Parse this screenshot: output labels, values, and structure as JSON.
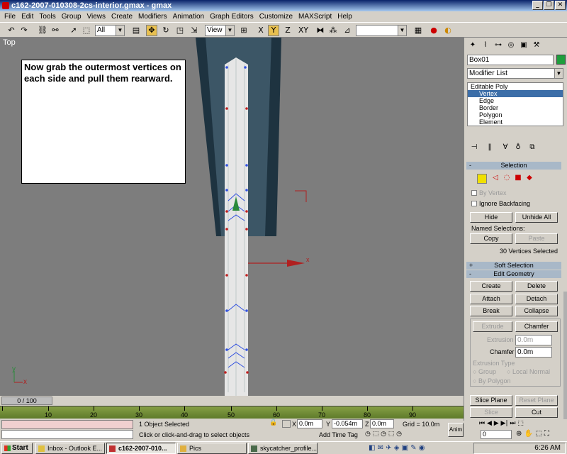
{
  "window": {
    "title": "c162-2007-010308-2cs-interior.gmax - gmax",
    "buttons": [
      "_",
      "❐",
      "✕"
    ]
  },
  "menu": [
    "File",
    "Edit",
    "Tools",
    "Group",
    "Views",
    "Create",
    "Modifiers",
    "Animation",
    "Graph Editors",
    "Customize",
    "MAXScript",
    "Help"
  ],
  "toolbar": {
    "selection_filter": "All",
    "ref_coord": "View",
    "named_sel": ""
  },
  "viewport": {
    "label": "Top",
    "note": "Now grab the outermost vertices on each side and pull them rearward.",
    "axis_y": "y",
    "axis_x": "x"
  },
  "command_panel": {
    "object_name": "Box01",
    "object_color": "#1e9e3c",
    "modifier_list": "Modifier List",
    "stack": [
      "Editable Poly",
      "Vertex",
      "Edge",
      "Border",
      "Polygon",
      "Element"
    ],
    "selection": {
      "title": "Selection",
      "by_vertex": "By Vertex",
      "ignore_backfacing": "Ignore Backfacing",
      "hide": "Hide",
      "unhide_all": "Unhide All",
      "named_selections": "Named Selections:",
      "copy": "Copy",
      "paste": "Paste",
      "status": "30 Vertices Selected"
    },
    "soft_selection": "Soft Selection",
    "edit_geometry": {
      "title": "Edit Geometry",
      "create": "Create",
      "delete": "Delete",
      "attach": "Attach",
      "detach": "Detach",
      "break": "Break",
      "collapse": "Collapse",
      "extrude": "Extrude",
      "chamfer": "Chamfer",
      "extrusion_label": "Extrusion",
      "extrusion_value": "0.0m",
      "chamfer_label": "Chamfer",
      "chamfer_value": "0.0m",
      "extrusion_type": "Extrusion Type",
      "group": "Group",
      "local_normal": "Local Normal",
      "by_polygon": "By Polygon",
      "slice_plane": "Slice Plane",
      "reset_plane": "Reset Plane",
      "slice": "Slice",
      "cut": "Cut"
    }
  },
  "timeline": {
    "slider": "0 / 100",
    "ticks": [
      "10",
      "20",
      "30",
      "40",
      "50",
      "60",
      "70",
      "80",
      "90"
    ]
  },
  "status": {
    "selected": "1 Object Selected",
    "prompt": "Click or click-and-drag to select objects",
    "x_label": "X",
    "x_value": "0.0m",
    "y_label": "Y",
    "y_value": "-0.054m",
    "z_label": "Z",
    "z_value": "0.0m",
    "grid": "Grid = 10.0m",
    "add_time_tag": "Add Time Tag",
    "anim": "Anim",
    "frame": "0"
  },
  "taskbar": {
    "start": "Start",
    "tasks": [
      "Inbox - Outlook E...",
      "c162-2007-010...",
      "Pics",
      "skycatcher_profile..."
    ],
    "clock": "6:26 AM"
  }
}
